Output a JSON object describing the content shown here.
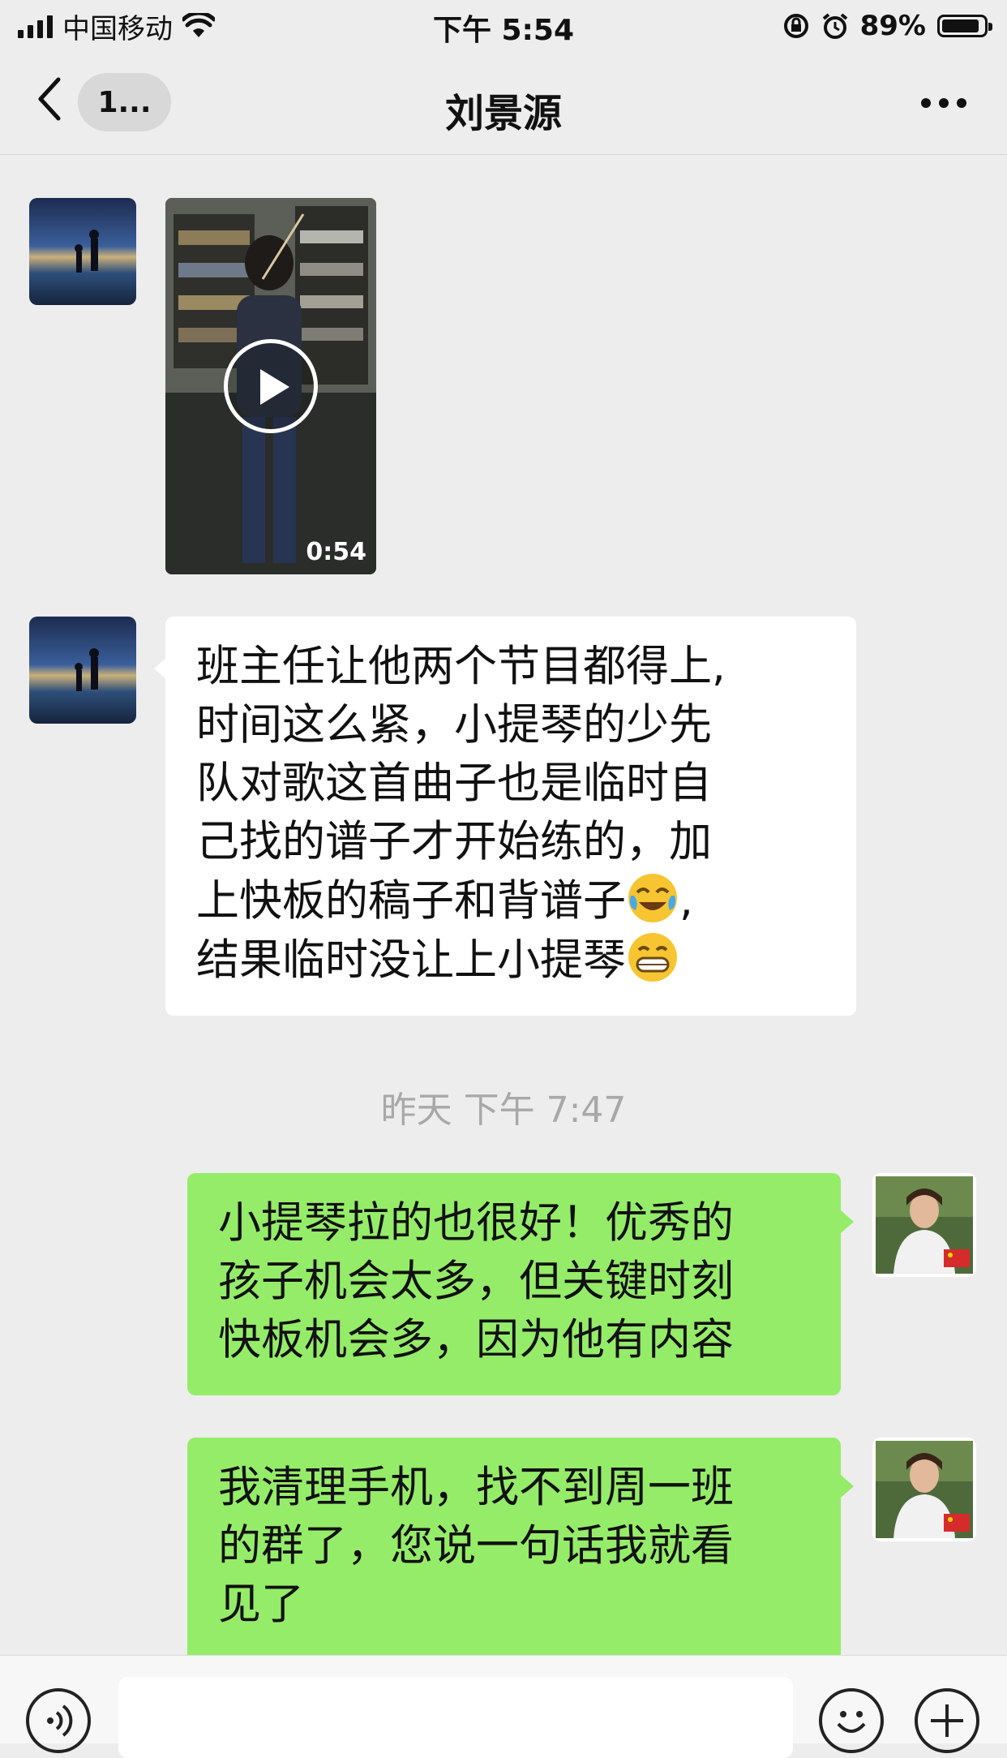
{
  "status_bar": {
    "carrier": "中国移动",
    "time": "下午 5:54",
    "battery_text": "89%",
    "battery_level": 0.89
  },
  "nav": {
    "unread_badge": "1...",
    "title": "刘景源",
    "icons": [
      "chevron-left-icon",
      "more-dots-icon"
    ]
  },
  "messages": [
    {
      "side": "in",
      "kind": "video",
      "duration": "0:54"
    },
    {
      "side": "in",
      "kind": "text",
      "lines": [
        "班主任让他两个节目都得上,",
        "时间这么紧，小提琴的少先",
        "队对歌这首曲子也是临时自",
        "己找的谱子才开始练的，加",
        "上快板的稿子和背谱子",
        "结果临时没让上小提琴"
      ],
      "line5_tail": ",",
      "emojis": [
        "crying-laughing-emoji",
        "grinning-emoji"
      ]
    },
    {
      "kind": "timestamp",
      "text": "昨天 下午 7:47"
    },
    {
      "side": "out",
      "kind": "text",
      "lines": [
        "小提琴拉的也很好！优秀的",
        "孩子机会太多，但关键时刻",
        "快板机会多，因为他有内容"
      ]
    },
    {
      "side": "out",
      "kind": "text",
      "lines": [
        "我清理手机，找不到周一班",
        "的群了，您说一句话我就看",
        "见了"
      ]
    }
  ],
  "input_bar": {
    "icons": [
      "voice-icon",
      "emoji-icon",
      "plus-icon"
    ]
  },
  "colors": {
    "background": "#ededed",
    "outgoing_bubble": "#95ec69",
    "incoming_bubble": "#ffffff",
    "timestamp_text": "#a8a8a8"
  }
}
